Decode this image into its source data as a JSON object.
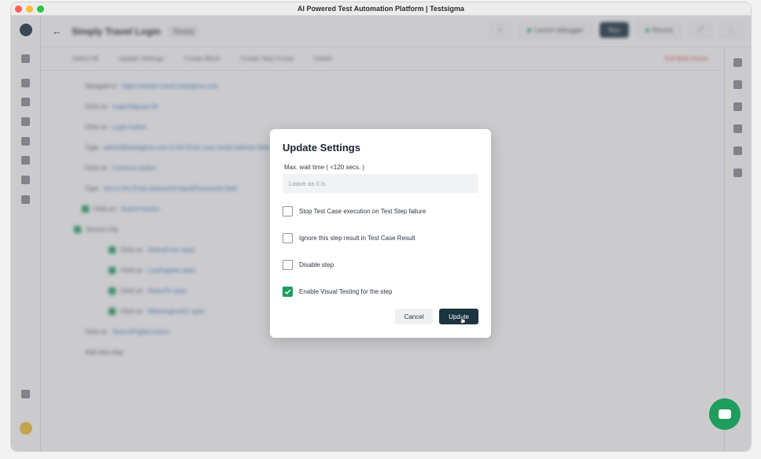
{
  "window": {
    "title": "AI Powered Test Automation Platform | Testsigma"
  },
  "topbar": {
    "title": "Simply Travel Login",
    "badge": "Ready",
    "buttons": [
      "Launch debugger",
      "Run",
      "Record"
    ]
  },
  "action_bar": {
    "items": [
      "Select All",
      "Update Settings",
      "Create Block",
      "Create Step Group",
      "Delete"
    ],
    "danger": "Exit Bulk Action"
  },
  "steps": [
    {
      "type": "plain",
      "text": "Navigate to",
      "value": "https://simply-travel.testsigma.com"
    },
    {
      "type": "plain",
      "text": "Click on",
      "value": "Login/Signup div"
    },
    {
      "type": "plain",
      "text": "Click on",
      "value": "Login button"
    },
    {
      "type": "plain",
      "text": "Type",
      "value": "admin@testsigma.com in the Enter your email address field"
    },
    {
      "type": "plain",
      "text": "Click on",
      "value": "Continue button"
    },
    {
      "type": "plain",
      "text": "Type",
      "value": "test in the Enter password input(Password) field"
    },
    {
      "type": "checked",
      "text": "Click on",
      "value": "Submit button"
    },
    {
      "type": "group",
      "text": "Source City",
      "value": ""
    },
    {
      "type": "sub",
      "text": "Click on",
      "value": "SelectFrom span"
    },
    {
      "type": "sub",
      "text": "Click on",
      "value": "LosAngeles span"
    },
    {
      "type": "sub",
      "text": "Click on",
      "value": "SelectTo span"
    },
    {
      "type": "sub",
      "text": "Click on",
      "value": "WashingtonDC span"
    },
    {
      "type": "plain",
      "text": "Click on",
      "value": "SearchFlights button"
    },
    {
      "type": "plain",
      "text": "Add new step",
      "value": ""
    }
  ],
  "modal": {
    "title": "Update Settings",
    "wait_label": "Max. wait time ( <120 secs. )",
    "wait_placeholder": "Leave as it is",
    "options": [
      {
        "label": "Stop Test Case execution on Test Step failure",
        "checked": false
      },
      {
        "label": "Ignore this step result in Test Case Result",
        "checked": false
      },
      {
        "label": "Disable step",
        "checked": false
      },
      {
        "label": "Enable Visual Testing for the step",
        "checked": true
      }
    ],
    "cancel_label": "Cancel",
    "update_label": "Update"
  },
  "colors": {
    "primary": "#1c3440",
    "success": "#1e9d5c",
    "danger": "#d6453b"
  }
}
